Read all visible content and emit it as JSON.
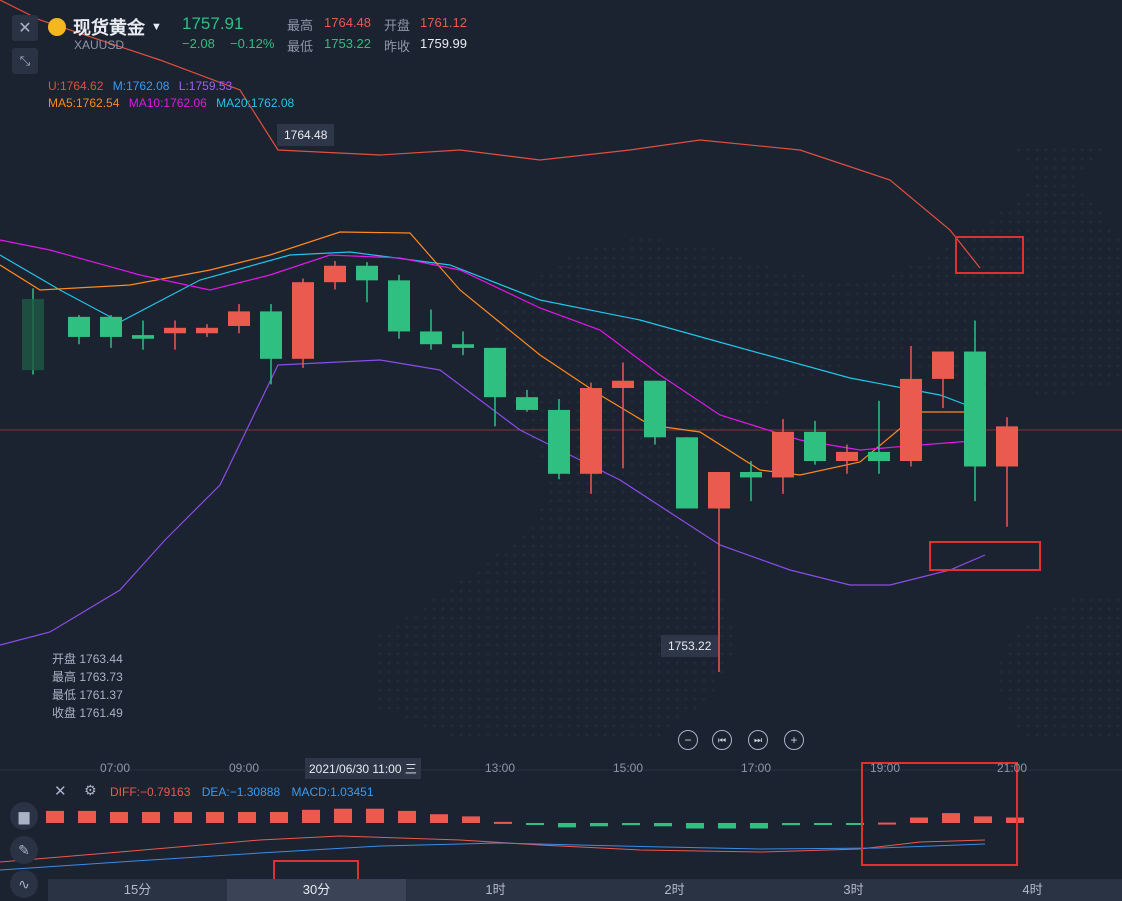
{
  "header": {
    "name": "现货黄金",
    "symbol": "XAUUSD",
    "price": "1757.91",
    "change": "−2.08",
    "change_pct": "−0.12%",
    "high_label": "最高",
    "high": "1764.48",
    "open_label": "开盘",
    "open": "1761.12",
    "low_label": "最低",
    "low": "1753.22",
    "prev_label": "昨收",
    "prev": "1759.99"
  },
  "indicators": {
    "boll_u": "U:1764.62",
    "boll_m": "M:1762.08",
    "boll_l": "L:1759.53",
    "ma5": "MA5:1762.54",
    "ma10": "MA10:1762.06",
    "ma20": "MA20:1762.08"
  },
  "markers": {
    "high": "1764.48",
    "low": "1753.22"
  },
  "ohlc": {
    "open_label": "开盘",
    "open": "1763.44",
    "high_label": "最高",
    "high": "1763.73",
    "low_label": "最低",
    "low": "1761.37",
    "close_label": "收盘",
    "close": "1761.49"
  },
  "time_axis": [
    "07:00",
    "09:00",
    "13:00",
    "15:00",
    "17:00",
    "19:00",
    "21:00"
  ],
  "crosshair_time": "2021/06/30 11:00 三",
  "macd": {
    "diff": "DIFF:−0.79163",
    "dea": "DEA:−1.30888",
    "macd": "MACD:1.03451"
  },
  "tabs": [
    "15分",
    "30分",
    "1时",
    "2时",
    "3时",
    "4时"
  ],
  "active_tab": "30分",
  "colors": {
    "up": "#ea5a4e",
    "down": "#2fbf80",
    "bg": "#1b2230",
    "boll_u": "#e05040",
    "boll_m": "#22c5e8",
    "boll_l": "#8a4ee8",
    "ma5": "#ff8a1e",
    "ma10": "#e018e8"
  },
  "chart_data": {
    "type": "candlestick",
    "candles": [
      {
        "o": 1763.44,
        "h": 1763.73,
        "l": 1761.37,
        "c": 1761.49
      },
      {
        "o": 1762.95,
        "h": 1763.0,
        "l": 1762.2,
        "c": 1762.4
      },
      {
        "o": 1762.95,
        "h": 1763.0,
        "l": 1762.1,
        "c": 1762.4
      },
      {
        "o": 1762.45,
        "h": 1762.85,
        "l": 1762.05,
        "c": 1762.35
      },
      {
        "o": 1762.5,
        "h": 1762.85,
        "l": 1762.05,
        "c": 1762.65
      },
      {
        "o": 1762.5,
        "h": 1762.75,
        "l": 1762.4,
        "c": 1762.65
      },
      {
        "o": 1762.7,
        "h": 1763.3,
        "l": 1762.5,
        "c": 1763.1
      },
      {
        "o": 1763.1,
        "h": 1763.3,
        "l": 1761.1,
        "c": 1761.8
      },
      {
        "o": 1761.8,
        "h": 1764.0,
        "l": 1761.55,
        "c": 1763.9
      },
      {
        "o": 1763.9,
        "h": 1764.48,
        "l": 1763.7,
        "c": 1764.35
      },
      {
        "o": 1764.35,
        "h": 1764.45,
        "l": 1763.35,
        "c": 1763.95
      },
      {
        "o": 1763.95,
        "h": 1764.1,
        "l": 1762.35,
        "c": 1762.55
      },
      {
        "o": 1762.55,
        "h": 1763.15,
        "l": 1762.05,
        "c": 1762.2
      },
      {
        "o": 1762.2,
        "h": 1762.55,
        "l": 1761.9,
        "c": 1762.1
      },
      {
        "o": 1762.1,
        "h": 1762.1,
        "l": 1759.95,
        "c": 1760.75
      },
      {
        "o": 1760.75,
        "h": 1760.95,
        "l": 1760.35,
        "c": 1760.4
      },
      {
        "o": 1760.4,
        "h": 1760.7,
        "l": 1758.5,
        "c": 1758.65
      },
      {
        "o": 1758.65,
        "h": 1761.15,
        "l": 1758.1,
        "c": 1761.0
      },
      {
        "o": 1761.0,
        "h": 1761.7,
        "l": 1758.8,
        "c": 1761.2
      },
      {
        "o": 1761.2,
        "h": 1761.2,
        "l": 1759.45,
        "c": 1759.65
      },
      {
        "o": 1759.65,
        "h": 1759.65,
        "l": 1757.7,
        "c": 1757.7
      },
      {
        "o": 1757.7,
        "h": 1758.7,
        "l": 1753.22,
        "c": 1758.7
      },
      {
        "o": 1758.7,
        "h": 1759.0,
        "l": 1757.9,
        "c": 1758.55
      },
      {
        "o": 1758.55,
        "h": 1760.15,
        "l": 1758.1,
        "c": 1759.8
      },
      {
        "o": 1759.8,
        "h": 1760.1,
        "l": 1758.9,
        "c": 1759.0
      },
      {
        "o": 1759.0,
        "h": 1759.45,
        "l": 1758.65,
        "c": 1759.25
      },
      {
        "o": 1759.25,
        "h": 1760.65,
        "l": 1758.65,
        "c": 1759.0
      },
      {
        "o": 1759.0,
        "h": 1762.15,
        "l": 1758.85,
        "c": 1761.25
      },
      {
        "o": 1761.25,
        "h": 1761.55,
        "l": 1760.45,
        "c": 1762.0
      },
      {
        "o": 1762.0,
        "h": 1762.85,
        "l": 1757.9,
        "c": 1758.85
      },
      {
        "o": 1758.85,
        "h": 1760.2,
        "l": 1757.2,
        "c": 1759.95
      }
    ],
    "macd_hist": [
      0.55,
      0.55,
      0.5,
      0.5,
      0.5,
      0.5,
      0.5,
      0.5,
      0.6,
      0.65,
      0.65,
      0.55,
      0.4,
      0.3,
      0.05,
      -0.05,
      -0.2,
      -0.15,
      -0.1,
      -0.15,
      -0.25,
      -0.25,
      -0.25,
      -0.1,
      -0.05,
      -0.05,
      0.02,
      0.25,
      0.45,
      0.3,
      0.25
    ]
  }
}
